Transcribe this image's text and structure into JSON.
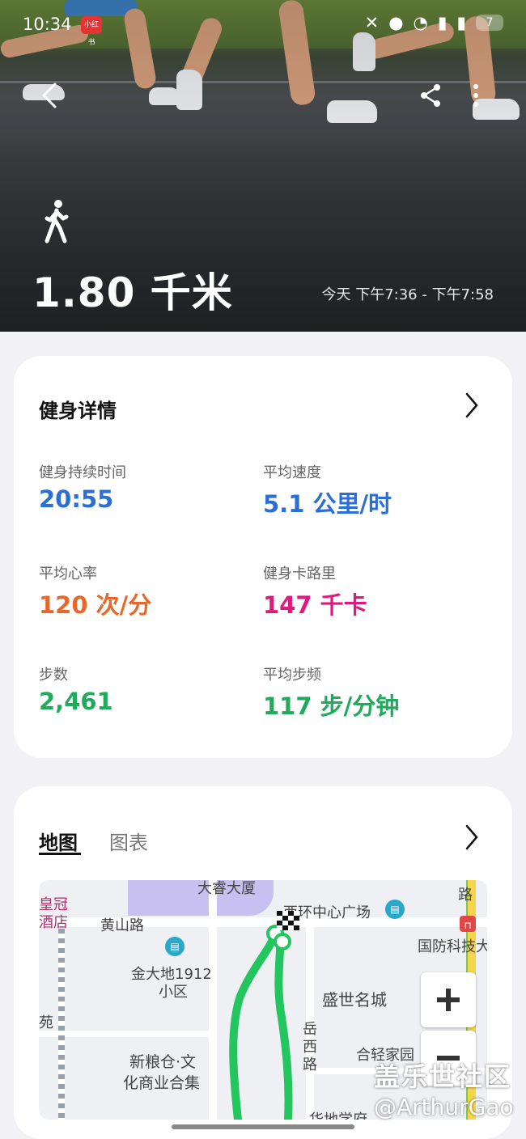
{
  "status_bar": {
    "time": "10:34",
    "app_badge": "小红书",
    "battery": "7"
  },
  "workout": {
    "distance": "1.80 千米",
    "time_range": "今天 下午7:36 - 下午7:58"
  },
  "details": {
    "title": "健身详情",
    "metrics": [
      {
        "label": "健身持续时间",
        "value": "20:55",
        "color": "#2b6fd6"
      },
      {
        "label": "平均速度",
        "value": "5.1 公里/时",
        "color": "#2b6fd6"
      },
      {
        "label": "平均心率",
        "value": "120 次/分",
        "color": "#e8672a"
      },
      {
        "label": "健身卡路里",
        "value": "147 千卡",
        "color": "#e0197d"
      },
      {
        "label": "步数",
        "value": "2,461",
        "color": "#1faa5c"
      },
      {
        "label": "平均步频",
        "value": "117 步/分钟",
        "color": "#1faa5c"
      }
    ]
  },
  "map_section": {
    "tabs": [
      "地图",
      "图表"
    ],
    "labels": {
      "building_top": "大睿大厦",
      "hotel_1": "皇冠",
      "hotel_2": "酒店",
      "road_huangshan": "黄山路",
      "plaza": "西环中心广场",
      "defense": "国防科技大",
      "community_1": "金大地1912",
      "community_2": "小区",
      "yuan": "苑",
      "shengshi": "盛世名城",
      "yuexi_1": "岳",
      "yuexi_2": "西",
      "yuexi_3": "路",
      "grain_1": "新粮仓·文",
      "grain_2": "化商业合集",
      "hefei": "合轻家园",
      "road_right": "路",
      "bottom": "华地学府"
    },
    "route_color": "#22c55e"
  },
  "watermark": {
    "line1": "盖乐世社区",
    "line2": "@ArthurGao"
  }
}
